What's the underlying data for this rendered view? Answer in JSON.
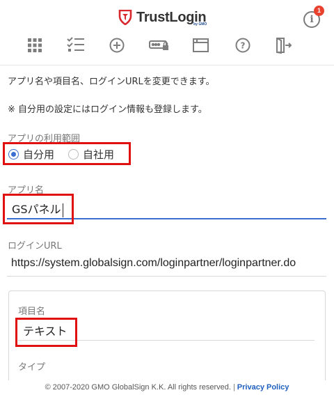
{
  "header": {
    "logo_text": "TrustLogin",
    "logo_sub": "by GMO",
    "info_icon": "info-icon",
    "notification_count": "1",
    "brand_color": "#d9292f",
    "toolbar": [
      {
        "name": "apps-grid-icon"
      },
      {
        "name": "checklist-icon"
      },
      {
        "name": "add-circle-icon"
      },
      {
        "name": "password-field-icon"
      },
      {
        "name": "window-icon"
      },
      {
        "name": "help-icon"
      },
      {
        "name": "logout-icon"
      }
    ]
  },
  "intro": {
    "line1": "アプリ名や項目名、ログインURLを変更できます。",
    "line2": "※ 自分用の設定にはログイン情報も登録します。"
  },
  "usage_scope": {
    "label": "アプリの利用範囲",
    "options": [
      {
        "label": "自分用",
        "checked": true
      },
      {
        "label": "自社用",
        "checked": false
      }
    ]
  },
  "app_name": {
    "label": "アプリ名",
    "value": "GSパネル"
  },
  "login_url": {
    "label": "ログインURL",
    "value": "https://system.globalsign.com/loginpartner/loginpartner.do"
  },
  "item_panel": {
    "item_name_label": "項目名",
    "item_name_value": "テキスト",
    "type_label": "タイプ"
  },
  "footer": {
    "copyright": "© 2007-2020 GMO GlobalSign K.K. All rights reserved.",
    "separator": "|",
    "privacy_link": "Privacy Policy"
  },
  "colors": {
    "accent": "#3a6fd0",
    "highlight": "#e01010",
    "badge": "#e8412e"
  }
}
